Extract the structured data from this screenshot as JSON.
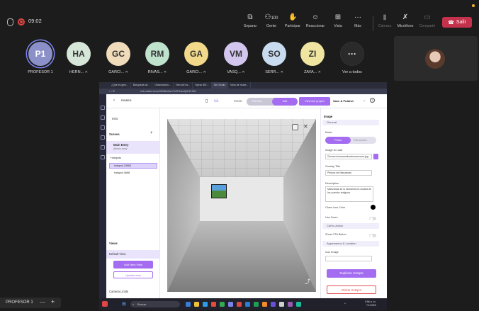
{
  "meeting": {
    "time": "09:02",
    "toolbar": [
      {
        "id": "separate",
        "label": "Separar",
        "icon": "popout-icon",
        "dim": false
      },
      {
        "id": "people",
        "label": "Gente",
        "icon": "people-icon",
        "badge": "100",
        "dim": false
      },
      {
        "id": "participate",
        "label": "Participar",
        "icon": "raise-hand-icon",
        "dim": false
      },
      {
        "id": "react",
        "label": "Reaccionar",
        "icon": "smile-icon",
        "dim": false
      },
      {
        "id": "view",
        "label": "Vista",
        "icon": "grid-icon",
        "dim": false
      },
      {
        "id": "more",
        "label": "Más",
        "icon": "more-icon",
        "dim": false
      },
      {
        "id": "camera",
        "label": "Cámara",
        "icon": "camera-off-icon",
        "dim": true
      },
      {
        "id": "mic",
        "label": "Micrófono",
        "icon": "mic-off-icon",
        "dim": false
      },
      {
        "id": "share",
        "label": "Compartir",
        "icon": "share-screen-icon",
        "dim": true
      }
    ],
    "leave_label": "Salir"
  },
  "participants": [
    {
      "initials": "P1",
      "name": "PROFESOR 1",
      "color": "#8b91c8"
    },
    {
      "initials": "HA",
      "name": "HERN...",
      "color": "#d6e6d9"
    },
    {
      "initials": "GC",
      "name": "GARCI...",
      "color": "#f0dbbb"
    },
    {
      "initials": "RM",
      "name": "RIVAS...",
      "color": "#bfe2cc"
    },
    {
      "initials": "GA",
      "name": "GARCI...",
      "color": "#f2d98a"
    },
    {
      "initials": "VM",
      "name": "VASQ...",
      "color": "#d2c6ee"
    },
    {
      "initials": "SO",
      "name": "SERR...",
      "color": "#c8dbef"
    },
    {
      "initials": "ZI",
      "name": "ZAVA...",
      "color": "#f0e5a0"
    }
  ],
  "more_participants": {
    "label": "Ver a todos",
    "glyph": "···"
  },
  "presenter": {
    "name": "PROFESOR 1",
    "minus": "—",
    "plus": "+"
  },
  "shared_screen": {
    "tabs": [
      "¿Qué es gesi...",
      "Búsqueda de...",
      "Observación...",
      "Otro ahí es...",
      "Opera IDE...",
      "360 Studio",
      "fotos de muse..."
    ],
    "url": "hub.walker.tools/360/Builder/?k0P1/Ae2j0KKHl0C",
    "header": {
      "title": "museo",
      "mode_label": "Mode:",
      "preview": "Preview",
      "edit": "Edit",
      "view_live": "View live project",
      "save_publish": "Save & Publish",
      "help": "?"
    },
    "left_panel": {
      "intro": "Intro",
      "scenes": "Scenes",
      "add": "+",
      "main_entry": "Main Entry",
      "main_entry_sub": "@main-entry",
      "hotspots": "Hotspots",
      "hotspot_1": "hotspot-23563",
      "hotspot_2": "hotspot-4668",
      "views": "Views",
      "default_view": "Default View",
      "add_view": "Add New View",
      "update_view": "Update view",
      "camera_limits": "Camera Limits"
    },
    "right_panel": {
      "title": "Image",
      "general": "General",
      "mode": "Mode",
      "photo": "Photo",
      "fullscreen": "Full screen",
      "image_to_load": "Image to Load",
      "image_value": "2/museo/manzanitosdemanzana.jpg",
      "overlay_title": "Overlay Title",
      "overlay_value": "Pintura de Manzanas",
      "description": "Description",
      "description_value": "Manzanas se lo llamamos la ciudad de los puertos antiguos",
      "close_icon_color": "Close Icon Color",
      "use_zoom": "Use Zoom",
      "call_to_action": "Call to Action",
      "show_cta": "Show CTA Button",
      "appearance": "Appearance & Location",
      "icon_image": "Icon Image",
      "duplicate": "Duplicate Hotspot",
      "delete": "Delete Hotspot"
    },
    "taskbar": {
      "search": "Buscar",
      "time": "9:56 a. m.",
      "date": "7/1/2025"
    }
  }
}
